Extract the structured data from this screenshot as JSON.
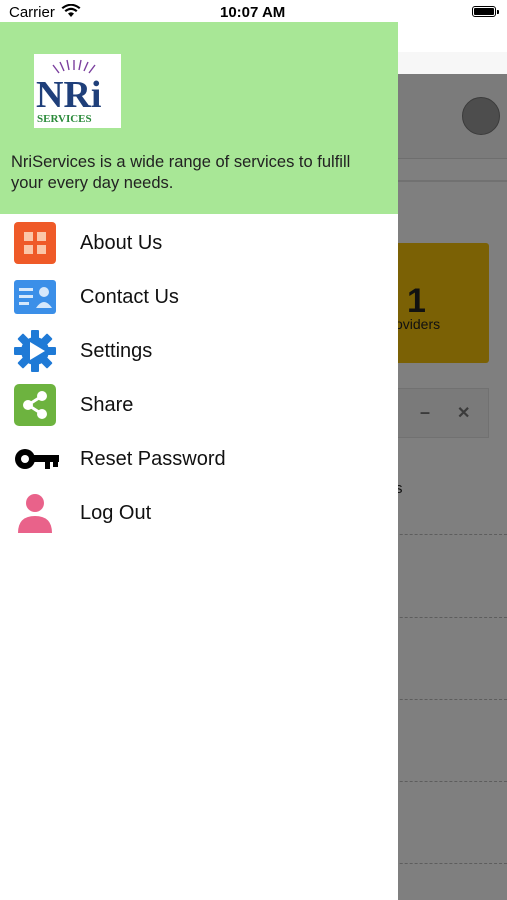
{
  "status_bar": {
    "carrier": "Carrier",
    "time": "10:07 AM"
  },
  "drawer": {
    "logo": {
      "text_main": "NRi",
      "text_sub": "SERVICES"
    },
    "description": "NriServices is a  wide range of services to fulfill your every day needs.",
    "header_color": "#a8e796",
    "menu": [
      {
        "label": "About Us",
        "icon": "grid-icon",
        "color": "#ef5a28"
      },
      {
        "label": "Contact Us",
        "icon": "contact-card-icon",
        "color": "#3b8fe8"
      },
      {
        "label": "Settings",
        "icon": "gear-play-icon",
        "color": "#1f7ad6"
      },
      {
        "label": "Share",
        "icon": "share-icon",
        "color": "#6db33f"
      },
      {
        "label": "Reset Password",
        "icon": "key-icon",
        "color": "#000000"
      },
      {
        "label": "Log Out",
        "icon": "user-icon",
        "color": "#e9628a"
      }
    ]
  },
  "background_app": {
    "card_value": "1",
    "card_label": "oviders",
    "list_fragment": "s"
  }
}
